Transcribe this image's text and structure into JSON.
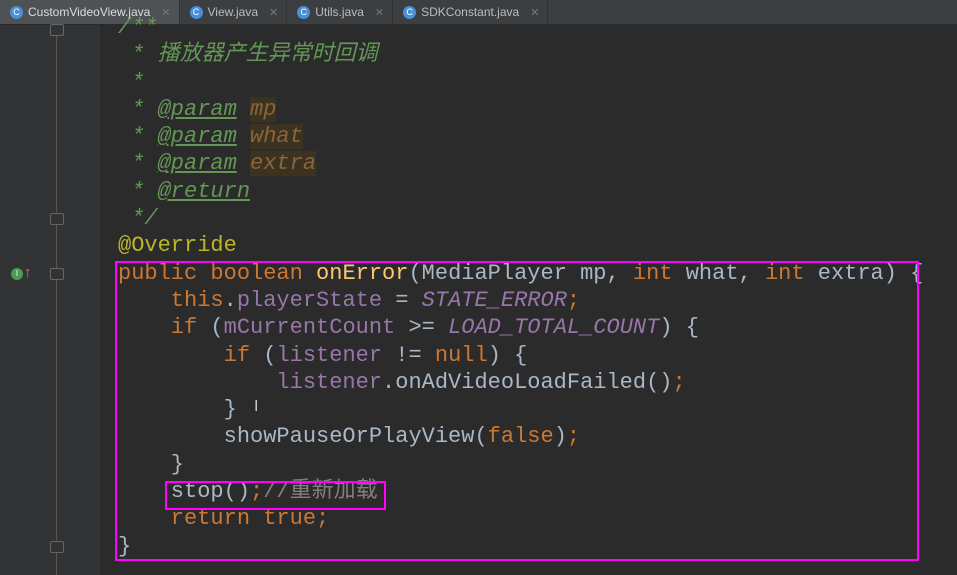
{
  "tabs": [
    {
      "label": "CustomVideoView.java",
      "active": true
    },
    {
      "label": "View.java"
    },
    {
      "label": "Utils.java"
    },
    {
      "label": "SDKConstant.java"
    }
  ],
  "gutter": {
    "marker_label": "I"
  },
  "code": [
    [
      [
        "cm",
        "/**"
      ]
    ],
    [
      [
        "cm",
        " * 播放器产生异常时回调"
      ]
    ],
    [
      [
        "cm",
        " *"
      ]
    ],
    [
      [
        "cm",
        " * "
      ],
      [
        "tag",
        "@param"
      ],
      [
        "cm",
        " "
      ],
      [
        "pn",
        "mp"
      ]
    ],
    [
      [
        "cm",
        " * "
      ],
      [
        "tag",
        "@param"
      ],
      [
        "cm",
        " "
      ],
      [
        "pn",
        "what"
      ]
    ],
    [
      [
        "cm",
        " * "
      ],
      [
        "tag",
        "@param"
      ],
      [
        "cm",
        " "
      ],
      [
        "pn",
        "extra"
      ]
    ],
    [
      [
        "cm",
        " * "
      ],
      [
        "tag",
        "@return"
      ]
    ],
    [
      [
        "cm",
        " */"
      ]
    ],
    [
      [
        "an",
        "@Override"
      ]
    ],
    [
      [
        "kw",
        "public boolean "
      ],
      [
        "fn",
        "onError"
      ],
      [
        "tx",
        "(MediaPlayer mp, "
      ],
      [
        "kw",
        "int "
      ],
      [
        "tx",
        "what, "
      ],
      [
        "kw",
        "int "
      ],
      [
        "tx",
        "extra) {"
      ]
    ],
    [
      [
        "kw",
        "    this"
      ],
      [
        "tx",
        "."
      ],
      [
        "fd",
        "playerState"
      ],
      [
        "tx",
        " = "
      ],
      [
        "cs",
        "STATE_ERROR"
      ],
      [
        "kw",
        ";"
      ]
    ],
    [
      [
        "kw",
        "    if "
      ],
      [
        "tx",
        "("
      ],
      [
        "fd",
        "mCurrentCount"
      ],
      [
        "tx",
        " >= "
      ],
      [
        "cs",
        "LOAD_TOTAL_COUNT"
      ],
      [
        "tx",
        ") {"
      ]
    ],
    [
      [
        "kw",
        "        if "
      ],
      [
        "tx",
        "("
      ],
      [
        "fd",
        "listener"
      ],
      [
        "tx",
        " != "
      ],
      [
        "kw",
        "null"
      ],
      [
        "tx",
        ") {"
      ]
    ],
    [
      [
        "fd",
        "            listener"
      ],
      [
        "tx",
        ".onAdVideoLoadFailed()"
      ],
      [
        "kw",
        ";"
      ]
    ],
    [
      [
        "tx",
        "        }"
      ]
    ],
    [
      [
        "tx",
        "        showPauseOrPlayView("
      ],
      [
        "kw",
        "false"
      ],
      [
        "tx",
        ")"
      ],
      [
        "kw",
        ";"
      ]
    ],
    [
      [
        "tx",
        "    }"
      ]
    ],
    [
      [
        "tx",
        "    stop()"
      ],
      [
        "kw",
        ";"
      ],
      [
        "gc",
        "//重新加载"
      ]
    ],
    [
      [
        "kw",
        "    return true;"
      ]
    ],
    [
      [
        "tx",
        "}"
      ]
    ]
  ]
}
